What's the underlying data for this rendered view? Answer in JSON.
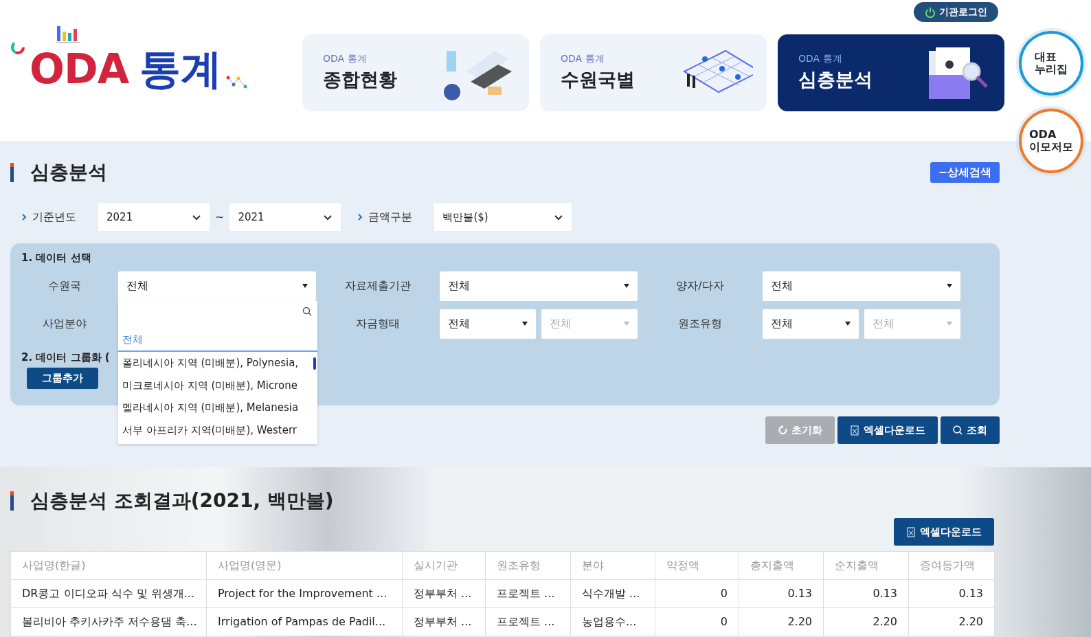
{
  "header": {
    "logo": {
      "first": "ODA",
      "second": "통계"
    },
    "login_button": "기관로그인",
    "nav_cards": [
      {
        "eyebrow": "ODA 통계",
        "title": "종합현황",
        "selected": false
      },
      {
        "eyebrow": "ODA 통계",
        "title": "수원국별",
        "selected": false
      },
      {
        "eyebrow": "ODA 통계",
        "title": "심층분석",
        "selected": true
      }
    ],
    "side_buttons": [
      {
        "lines": [
          "대표",
          "누리집"
        ],
        "color": "#1a9ad6"
      },
      {
        "lines": [
          "ODA",
          "이모저모"
        ],
        "color": "#f07a2a"
      }
    ]
  },
  "search": {
    "title": "심층분석",
    "detail_button": "−상세검색",
    "filters": [
      {
        "kind": "range",
        "label": "기준년도",
        "from": "2021",
        "separator": "~",
        "to": "2021"
      },
      {
        "kind": "select",
        "label": "금액구분",
        "value": "백만불($)"
      }
    ],
    "data_panel": {
      "title": "1. 데이터 선택",
      "fields": [
        {
          "label": "수원국",
          "selects": [
            {
              "value": "전체",
              "disabled": false
            }
          ]
        },
        {
          "label": "자료제출기관",
          "selects": [
            {
              "value": "전체",
              "disabled": false
            }
          ]
        },
        {
          "label": "양자/다자",
          "selects": [
            {
              "value": "전체",
              "disabled": false
            }
          ]
        },
        {
          "label": "사업분야"
        },
        {
          "label": "자금형태",
          "selects": [
            {
              "value": "전체",
              "disabled": false
            },
            {
              "value": "전체",
              "disabled": true
            }
          ]
        },
        {
          "label": "원조유형",
          "selects": [
            {
              "value": "전체",
              "disabled": false
            },
            {
              "value": "전체",
              "disabled": true
            }
          ]
        }
      ],
      "group_title": "2. 데이터 그룹화 (",
      "group_button": "그룹추가"
    },
    "dropdown": {
      "options": [
        {
          "label": "전체",
          "selected": true
        },
        {
          "label": "폴리네시아 지역 (미배분), Polynesia,",
          "selected": false
        },
        {
          "label": "미크로네시아 지역 (미배분), Microne",
          "selected": false
        },
        {
          "label": "멜라네시아 지역 (미배분), Melanesia",
          "selected": false
        },
        {
          "label": "서부 아프리카 지역(미배분), Westerr",
          "selected": false
        }
      ]
    },
    "actions": [
      {
        "kind": "reset",
        "label": "초기화"
      },
      {
        "kind": "excel",
        "label": "엑셀다운로드"
      },
      {
        "kind": "search",
        "label": "조회"
      }
    ]
  },
  "results": {
    "title": "심층분석 조회결과(2021, 백만불)",
    "excel_button": "엑셀다운로드",
    "table": {
      "columns": [
        "사업명(한글)",
        "사업명(영문)",
        "실시기관",
        "원조유형",
        "분야",
        "약정액",
        "총지출액",
        "순지출액",
        "증여등가액"
      ],
      "rows": [
        [
          "DR콩고 이디오파 식수 및 위생개...",
          "Project for the Improvement ...",
          "정부부처 ...",
          "프로젝트 ...",
          "식수개발 ...",
          "0",
          "0.13",
          "0.13",
          "0.13"
        ],
        [
          "볼리비아 추키사카주 저수용댐 축...",
          "Irrigation of Pampas de Padil...",
          "정부부처 ...",
          "프로젝트 ...",
          "농업용수...",
          "0",
          "2.20",
          "2.20",
          "2.20"
        ]
      ]
    }
  }
}
